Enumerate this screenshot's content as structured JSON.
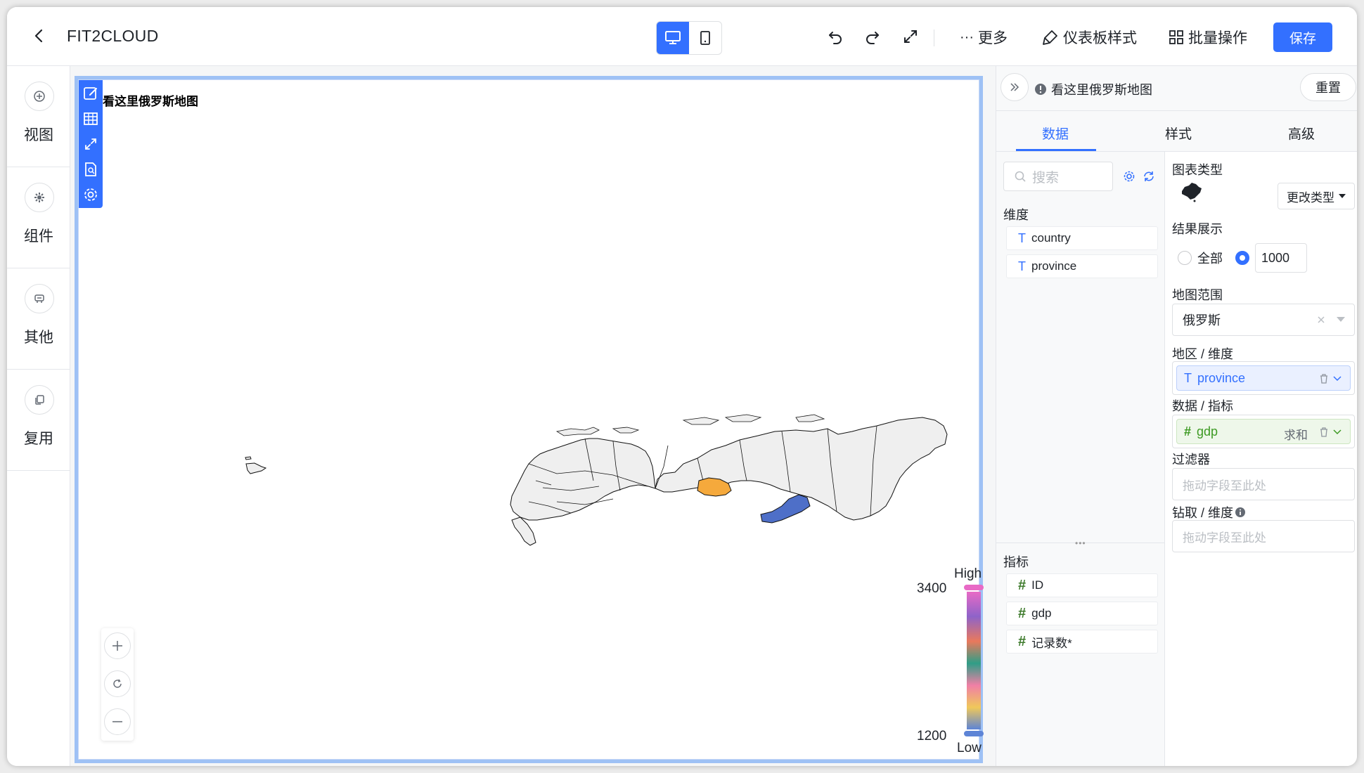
{
  "header": {
    "title": "FIT2CLOUD",
    "more_label": "更多",
    "dashboard_style_label": "仪表板样式",
    "batch_label": "批量操作",
    "save_label": "保存"
  },
  "sidebar": {
    "items": [
      {
        "label": "视图",
        "icon": "plus-circle-icon"
      },
      {
        "label": "组件",
        "icon": "gear-icon"
      },
      {
        "label": "其他",
        "icon": "chat-icon"
      },
      {
        "label": "复用",
        "icon": "copy-icon"
      }
    ]
  },
  "widget": {
    "title": "看这里俄罗斯地图",
    "legend": {
      "high_label": "High",
      "low_label": "Low",
      "max": "3400",
      "min": "1200",
      "colors": [
        "#e86ac6",
        "#8e63c9",
        "#e9795c",
        "#2f9e86",
        "#f07fa6",
        "#f0c85a",
        "#5d84d6"
      ]
    },
    "region_colors": {
      "base": "#efefef",
      "highlight_orange": "#f5a93c",
      "highlight_blue": "#4e6fc8"
    }
  },
  "panel": {
    "title": "看这里俄罗斯地图",
    "reset_label": "重置",
    "tabs": [
      "数据",
      "样式",
      "高级"
    ],
    "active_tab": "数据",
    "search_placeholder": "搜索",
    "dimension_label": "维度",
    "dimensions": [
      "country",
      "province"
    ],
    "metric_label": "指标",
    "metrics": [
      "ID",
      "gdp",
      "记录数*"
    ],
    "chart_type_label": "图表类型",
    "change_type_label": "更改类型",
    "result_label": "结果展示",
    "result_all_label": "全部",
    "result_limit": "1000",
    "map_range_label": "地图范围",
    "map_range_value": "俄罗斯",
    "area_dim_label": "地区 / 维度",
    "area_dim_value": "province",
    "data_metric_label": "数据 / 指标",
    "data_metric_value": "gdp",
    "data_metric_agg": "求和",
    "filter_label": "过滤器",
    "drop_placeholder": "拖动字段至此处",
    "drill_label": "钻取 / 维度"
  }
}
